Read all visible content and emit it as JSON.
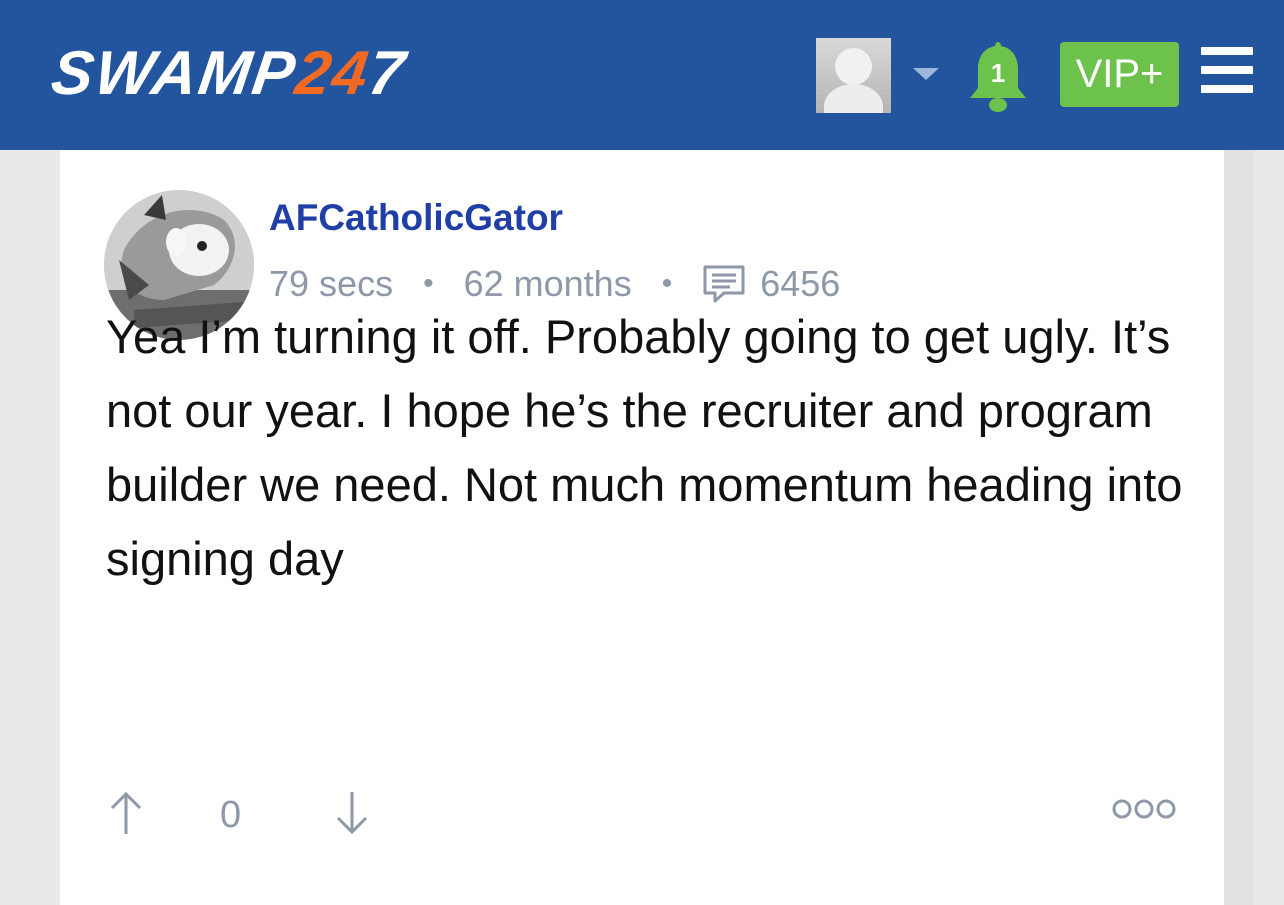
{
  "header": {
    "logo_swamp": "SWAMP",
    "logo_two_four": "24",
    "logo_seven": "7",
    "notification_count": "1",
    "vip_label": "VIP+"
  },
  "post": {
    "username": "AFCatholicGator",
    "posted_ago": "79 secs",
    "member_for": "62 months",
    "post_count": "6456",
    "body": "Yea I’m turning it off. Probably going to get ugly. It’s not our year. I hope he’s the recruiter and program builder we need. Not much momentum heading into signing day",
    "vote_score": "0"
  },
  "icons": {
    "profile": "avatar-placeholder-icon",
    "menu": "hamburger-menu-icon",
    "notifications": "bell-icon",
    "comments": "comment-icon",
    "upvote": "arrow-up-icon",
    "downvote": "arrow-down-icon",
    "options": "ellipsis-icon"
  },
  "colors": {
    "header_bg": "#23549e",
    "logo_accent": "#f26a21",
    "vip_bg": "#6cc24a",
    "username": "#1f3fa6",
    "meta_text": "#8e98a8"
  }
}
